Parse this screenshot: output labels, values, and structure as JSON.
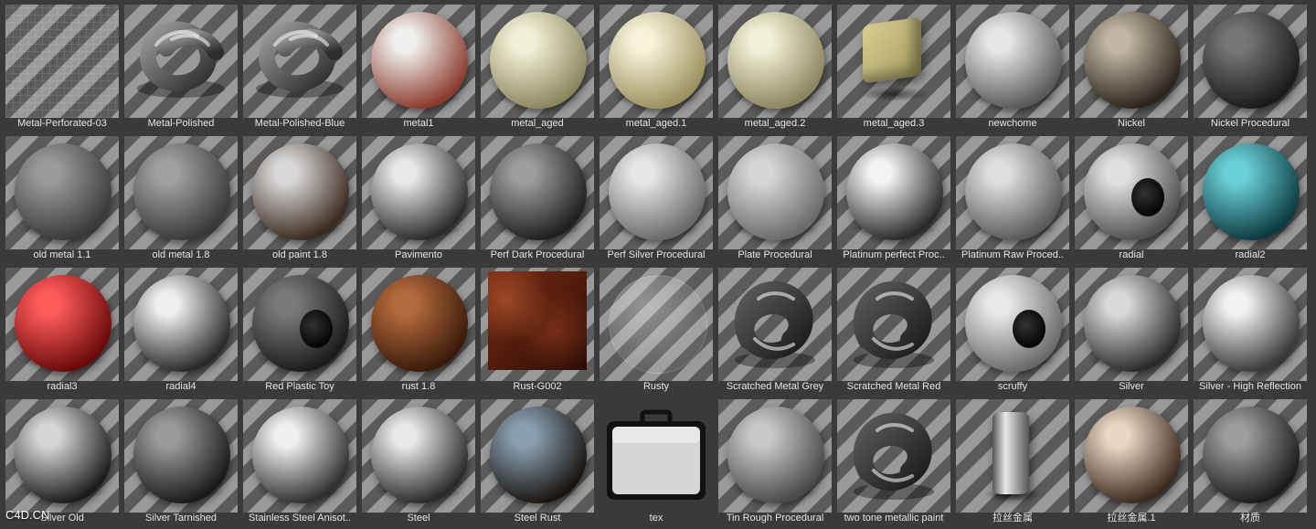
{
  "materials": [
    {
      "label": "Metal-Perforated-03",
      "kind": "grid",
      "colors": [
        "#6a6a6a",
        "#8a8a8a"
      ]
    },
    {
      "label": "Metal-Polished",
      "kind": "torus",
      "colors": [
        "#9a9a9a",
        "#2d2d2d"
      ]
    },
    {
      "label": "Metal-Polished-Blue",
      "kind": "torus",
      "colors": [
        "#c8d2ff",
        "#4a5a9a"
      ]
    },
    {
      "label": "metal1",
      "kind": "sphere",
      "colors": [
        "#f0f0ee",
        "#8b3b2d"
      ]
    },
    {
      "label": "metal_aged",
      "kind": "sphere",
      "colors": [
        "#f2f0d6",
        "#8c8660"
      ]
    },
    {
      "label": "metal_aged.1",
      "kind": "sphere",
      "colors": [
        "#f7f2d8",
        "#9d9160"
      ]
    },
    {
      "label": "metal_aged.2",
      "kind": "sphere",
      "colors": [
        "#f2f0d6",
        "#8c8660"
      ]
    },
    {
      "label": "metal_aged.3",
      "kind": "cube",
      "colors": [
        "#d8cf94",
        "#a59b5e"
      ]
    },
    {
      "label": "newchome",
      "kind": "sphere",
      "colors": [
        "#e7e7e7",
        "#5a5a5a"
      ]
    },
    {
      "label": "Nickel",
      "kind": "sphere",
      "colors": [
        "#c1b6a3",
        "#2c241c"
      ]
    },
    {
      "label": "Nickel Procedural",
      "kind": "sphere",
      "colors": [
        "#767676",
        "#1a1a1a"
      ]
    },
    {
      "label": "old metal 1.1",
      "kind": "sphere",
      "colors": [
        "#9a9a9a",
        "#3a3a3a"
      ]
    },
    {
      "label": "old metal 1.8",
      "kind": "sphere",
      "colors": [
        "#a0a0a0",
        "#3a3a3a"
      ]
    },
    {
      "label": "old paint 1.8",
      "kind": "sphere",
      "colors": [
        "#d8d8d8",
        "#3b2a1e"
      ]
    },
    {
      "label": "Pavimento",
      "kind": "sphere",
      "colors": [
        "#e8e8e8",
        "#2c2c2c"
      ]
    },
    {
      "label": "Perf Dark Procedural",
      "kind": "sphere",
      "colors": [
        "#9d9d9d",
        "#1f1f1f"
      ]
    },
    {
      "label": "Perf Silver Procedural",
      "kind": "sphere",
      "colors": [
        "#e6e6e6",
        "#6a6a6a"
      ]
    },
    {
      "label": "Plate Procedural",
      "kind": "sphere",
      "colors": [
        "#d6d6d6",
        "#6b6b6b"
      ]
    },
    {
      "label": "Platinum perfect Proc..",
      "kind": "sphere",
      "colors": [
        "#f3f3f3",
        "#2a2a2a"
      ]
    },
    {
      "label": "Platinum Raw Proced..",
      "kind": "sphere",
      "colors": [
        "#dedede",
        "#5a5a5a"
      ]
    },
    {
      "label": "radial",
      "kind": "ring",
      "colors": [
        "#e0e0e0",
        "#505050"
      ]
    },
    {
      "label": "radial2",
      "kind": "sphere",
      "colors": [
        "#6ad0d8",
        "#0d3a40"
      ]
    },
    {
      "label": "radial3",
      "kind": "sphere",
      "colors": [
        "#ff5a5a",
        "#6a0a0a"
      ]
    },
    {
      "label": "radial4",
      "kind": "sphere",
      "colors": [
        "#efefef",
        "#2a2a2a"
      ]
    },
    {
      "label": "Red Plastic Toy",
      "kind": "ring",
      "colors": [
        "#7a7a7a",
        "#1b1b1b"
      ]
    },
    {
      "label": "rust 1.8",
      "kind": "sphere",
      "colors": [
        "#b36a3c",
        "#3a1a0a"
      ]
    },
    {
      "label": "Rust-G002",
      "kind": "square",
      "colors": [
        "#7a2b14",
        "#2b0d05"
      ]
    },
    {
      "label": "Rusty",
      "kind": "ghost",
      "colors": [
        "#d0d0d0",
        "#6a6a6a"
      ]
    },
    {
      "label": "Scratched Metal Grey",
      "kind": "knot",
      "colors": [
        "#5a5a5a",
        "#1b1b1b"
      ]
    },
    {
      "label": "Scratched Metal Red",
      "kind": "knot",
      "colors": [
        "#e02020",
        "#5a0000"
      ]
    },
    {
      "label": "scruffy",
      "kind": "ring",
      "colors": [
        "#e8e8e8",
        "#6a6a6a"
      ]
    },
    {
      "label": "Silver",
      "kind": "sphere",
      "colors": [
        "#d9d9d9",
        "#2b2b2b"
      ]
    },
    {
      "label": "Silver - High Reflection",
      "kind": "sphere",
      "colors": [
        "#f2f2f2",
        "#3a3a3a"
      ]
    },
    {
      "label": "Silver Old",
      "kind": "sphere",
      "colors": [
        "#d6d6d6",
        "#1c1c1c"
      ]
    },
    {
      "label": "Silver Tarnished",
      "kind": "sphere",
      "colors": [
        "#9b9b9b",
        "#1a1a1a"
      ]
    },
    {
      "label": "Stainless Steel Anisot..",
      "kind": "sphere",
      "colors": [
        "#f0f0f0",
        "#303030"
      ]
    },
    {
      "label": "Steel",
      "kind": "sphere",
      "colors": [
        "#e8e8e8",
        "#2a2a2a"
      ]
    },
    {
      "label": "Steel Rust",
      "kind": "sphere",
      "colors": [
        "#8aa0b2",
        "#1a1410"
      ]
    },
    {
      "label": "tex",
      "kind": "case",
      "colors": [
        "#d6d6d6",
        "#1d1d1d"
      ]
    },
    {
      "label": "Tin Rough Procedural",
      "kind": "sphere",
      "colors": [
        "#c8c8c8",
        "#4a4a4a"
      ]
    },
    {
      "label": "two tone metallic paint",
      "kind": "knot",
      "colors": [
        "#ffd700",
        "#6a3d00"
      ]
    },
    {
      "label": "拉丝金属",
      "kind": "cyl",
      "colors": [
        "#e8e8e8",
        "#555555"
      ]
    },
    {
      "label": "拉丝金属.1",
      "kind": "sphere",
      "colors": [
        "#e8d8c4",
        "#3b2a1e"
      ]
    },
    {
      "label": "材质",
      "kind": "sphere",
      "colors": [
        "#9d9d9d",
        "#1b1b1b"
      ]
    }
  ],
  "watermark": "C4D.CN"
}
